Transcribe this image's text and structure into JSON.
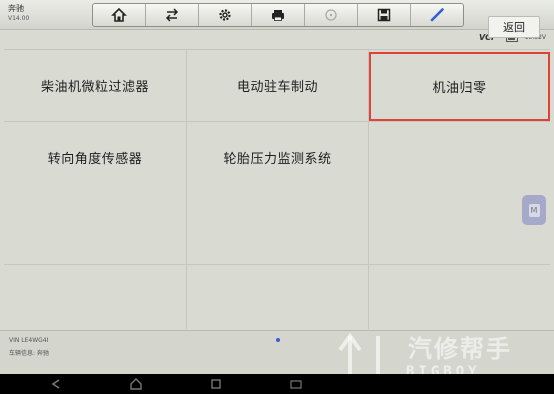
{
  "header": {
    "app_name": "奔驰",
    "app_version": "V14.00",
    "toolbar": [
      {
        "icon": "home-icon",
        "label": "Home"
      },
      {
        "icon": "swap-icon",
        "label": "Change vehicle"
      },
      {
        "icon": "gear-icon",
        "label": "Settings"
      },
      {
        "icon": "printer-icon",
        "label": "Print"
      },
      {
        "icon": "help-icon",
        "label": "Help"
      },
      {
        "icon": "save-icon",
        "label": "Save"
      },
      {
        "icon": "pen-icon",
        "label": "Edit"
      }
    ]
  },
  "status": {
    "vci": "VCI",
    "battery_icon": "battery-icon",
    "voltage": "13.32V"
  },
  "functions": [
    {
      "label": "柴油机微粒过滤器",
      "selected": false
    },
    {
      "label": "电动驻车制动",
      "selected": false
    },
    {
      "label": "机油归零",
      "selected": true
    },
    {
      "label": "转向角度传感器",
      "selected": false
    },
    {
      "label": "轮胎压力监测系统",
      "selected": false
    },
    {
      "label": "",
      "selected": false
    }
  ],
  "side_button": {
    "icon": "floating-menu-icon",
    "letter": "M"
  },
  "footer": {
    "vin": "VIN LE4WG4I",
    "system": "车辆信息: 奔驰",
    "mini_text": "",
    "back_label": "返回",
    "accent_color": "#3f5bd1"
  },
  "watermark": {
    "text": "汽修帮手",
    "latin": "BIGBOY"
  },
  "colors": {
    "selection": "#e0413a",
    "background": "#d9dbd3"
  }
}
